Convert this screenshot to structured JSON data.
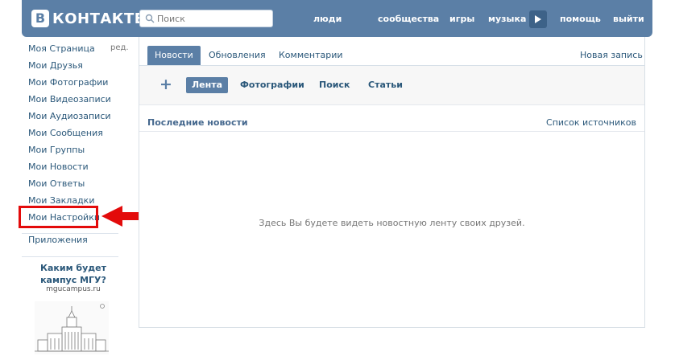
{
  "header": {
    "logo_letter": "В",
    "logo_text": "КОНТАКТЕ",
    "search_placeholder": "Поиск",
    "nav": {
      "people": "люди",
      "communities": "сообщества",
      "games": "игры",
      "music": "музыка",
      "help": "помощь",
      "logout": "выйти"
    }
  },
  "sidebar": {
    "edit_label": "ред.",
    "items": [
      {
        "label": "Моя Страница"
      },
      {
        "label": "Мои Друзья"
      },
      {
        "label": "Мои Фотографии"
      },
      {
        "label": "Мои Видеозаписи"
      },
      {
        "label": "Мои Аудиозаписи"
      },
      {
        "label": "Мои Сообщения"
      },
      {
        "label": "Мои Группы"
      },
      {
        "label": "Мои Новости"
      },
      {
        "label": "Мои Ответы"
      },
      {
        "label": "Мои Закладки"
      },
      {
        "label": "Мои Настройки",
        "highlighted": true
      },
      {
        "label": "Приложения"
      }
    ],
    "promo": {
      "title": "Каким будет кампус МГУ?",
      "url": "mgucampus.ru"
    }
  },
  "main": {
    "tabs": {
      "news": "Новости",
      "updates": "Обновления",
      "comments": "Комментарии"
    },
    "new_post": "Новая запись",
    "filters": {
      "plus": "+",
      "feed": "Лента",
      "photos": "Фотографии",
      "search": "Поиск",
      "articles": "Статьи"
    },
    "news_title": "Последние новости",
    "sources_link": "Список источников",
    "empty_message": "Здесь Вы будете видеть новостную ленту своих друзей."
  },
  "colors": {
    "brand": "#5b7fa6",
    "link": "#2b587a",
    "highlight": "#e30b0b"
  }
}
